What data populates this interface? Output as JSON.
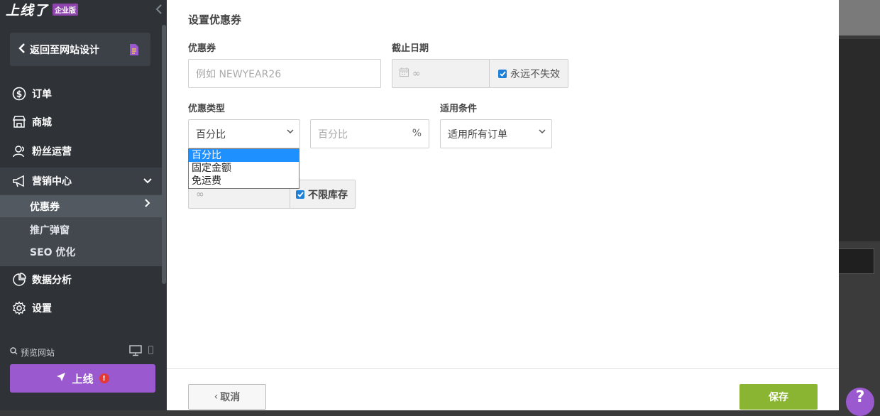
{
  "brand": {
    "name": "上线了",
    "badge": "企业版"
  },
  "sidebar": {
    "back_label": "返回至网站设计",
    "items": [
      {
        "label": "订单",
        "icon": "dollar-circle-icon"
      },
      {
        "label": "商城",
        "icon": "shop-icon"
      },
      {
        "label": "粉丝运营",
        "icon": "users-icon"
      },
      {
        "label": "营销中心",
        "icon": "megaphone-icon"
      },
      {
        "label": "数据分析",
        "icon": "pie-chart-icon"
      },
      {
        "label": "设置",
        "icon": "gear-icon"
      }
    ],
    "sub_items": [
      {
        "label": "优惠券"
      },
      {
        "label": "推广弹窗"
      },
      {
        "label": "SEO 优化"
      }
    ],
    "preview_label": "预览网站",
    "publish_label": "上线",
    "publish_warning": "!"
  },
  "panel": {
    "title": "设置优惠券",
    "coupon": {
      "label": "优惠券",
      "placeholder": "例如 NEWYEAR26"
    },
    "expiry": {
      "label": "截止日期",
      "placeholder": "∞",
      "never_label": "永远不失效"
    },
    "type": {
      "label": "优惠类型",
      "selected": "百分比",
      "options": [
        "百分比",
        "固定金额",
        "免运费"
      ]
    },
    "value": {
      "placeholder": "百分比",
      "unit": "%"
    },
    "condition": {
      "label": "适用条件",
      "selected": "适用所有订单"
    },
    "stock": {
      "placeholder": "∞",
      "unlimited_label": "不限库存"
    },
    "cancel_label": "取消",
    "cancel_chevron": "‹",
    "save_label": "保存"
  },
  "help": {
    "label": "?"
  },
  "colors": {
    "accent": "#9b59d0",
    "save": "#8ab532",
    "sidebar": "#2f3338"
  }
}
